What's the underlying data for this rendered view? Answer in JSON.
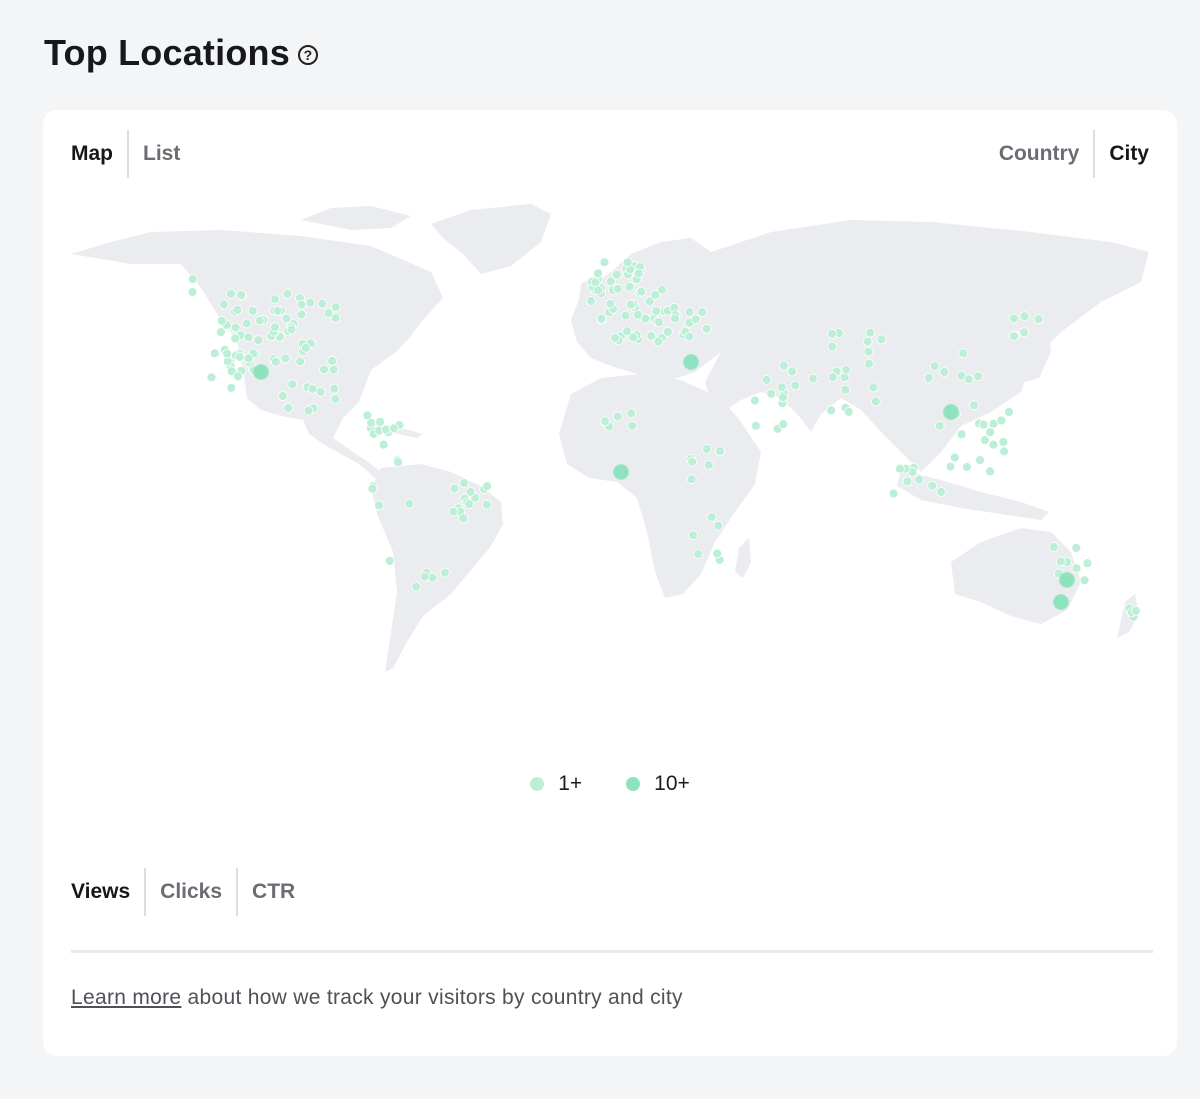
{
  "header": {
    "title": "Top Locations",
    "help_icon": "question-circle-icon"
  },
  "view_tabs": [
    {
      "label": "Map",
      "active": true
    },
    {
      "label": "List",
      "active": false
    }
  ],
  "geo_tabs": [
    {
      "label": "Country",
      "active": false
    },
    {
      "label": "City",
      "active": true
    }
  ],
  "legend": [
    {
      "label": "1+",
      "color": "#bdeed6"
    },
    {
      "label": "10+",
      "color": "#8fe2bf"
    }
  ],
  "metric_tabs": [
    {
      "label": "Views",
      "active": true
    },
    {
      "label": "Clicks",
      "active": false
    },
    {
      "label": "CTR",
      "active": false
    }
  ],
  "footer": {
    "link_text": "Learn more",
    "text": " about how we track your visitors by country and city"
  },
  "colors": {
    "land": "#ebecf0",
    "marker_1plus": "#bdeed6",
    "marker_10plus": "#8fe2bf",
    "marker_stroke": "#a6e6c9"
  }
}
